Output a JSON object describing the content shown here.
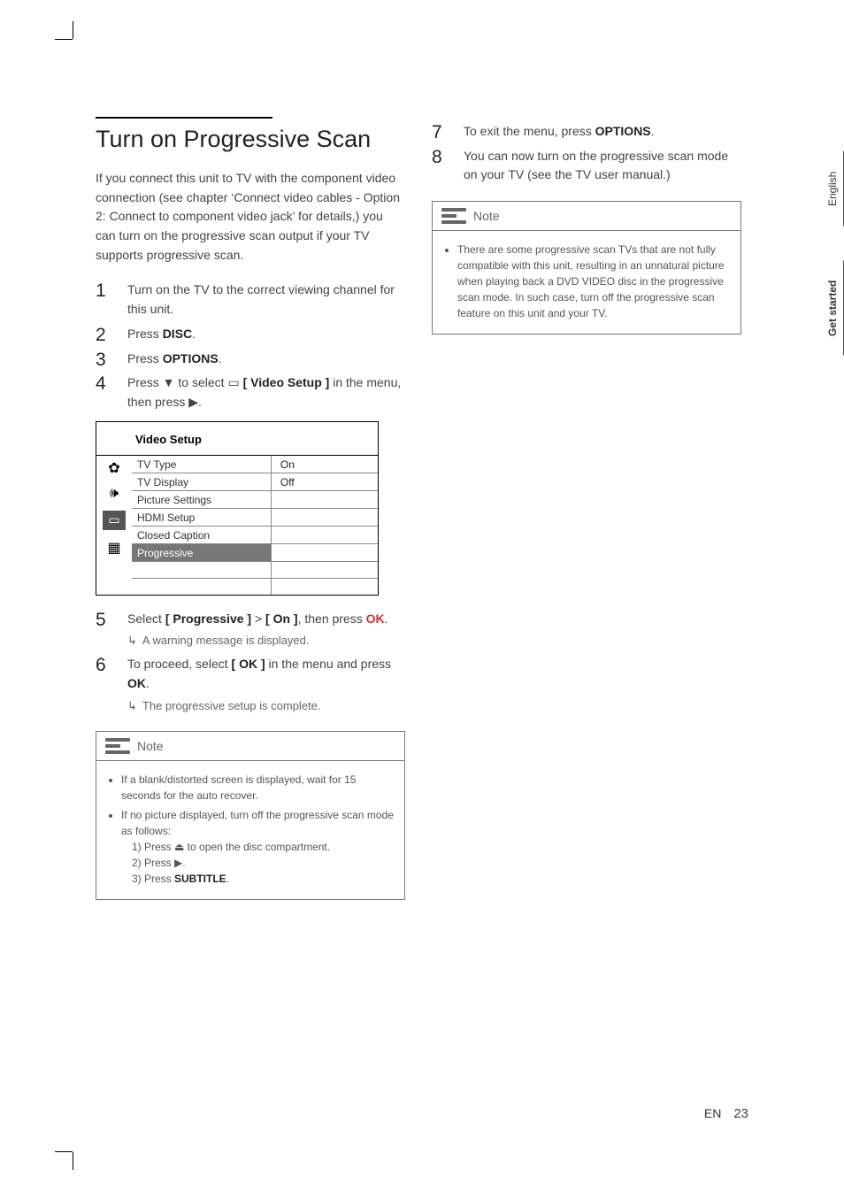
{
  "side_tabs": {
    "language": "English",
    "section": "Get started"
  },
  "footer": {
    "lang_code": "EN",
    "page_number": "23"
  },
  "heading": "Turn on Progressive Scan",
  "intro": "If you connect this unit to TV with the component video connection (see chapter ‘Connect video cables - Option 2: Connect to component video jack’ for details,) you can turn on the progressive scan output if your TV supports progressive scan.",
  "steps": {
    "s1": "Turn on the TV to the correct viewing channel for this unit.",
    "s2_a": "Press ",
    "s2_b": "DISC",
    "s2_c": ".",
    "s3_a": "Press ",
    "s3_b": "OPTIONS",
    "s3_c": ".",
    "s4_a": "Press ▼ to select ",
    "s4_b": "[ Video Setup ]",
    "s4_c": " in the menu, then press ▶.",
    "s5_a": "Select ",
    "s5_b": "[ Progressive ]",
    "s5_c": " > ",
    "s5_d": "[ On ]",
    "s5_e": ", then press ",
    "s5_ok": "OK",
    "s5_f": ".",
    "s5_sub": "A warning message is displayed.",
    "s6_a": "To proceed, select ",
    "s6_b": "[ OK ]",
    "s6_c": " in the menu and press ",
    "s6_d": "OK",
    "s6_e": ".",
    "s6_sub": "The progressive setup is complete.",
    "s7_a": "To exit the menu, press ",
    "s7_b": "OPTIONS",
    "s7_c": ".",
    "s8": "You can now turn on the progressive scan mode on your TV (see the TV user manual.)"
  },
  "osd": {
    "title": "Video Setup",
    "items": {
      "tv_type": "TV Type",
      "tv_display": "TV Display",
      "picture_settings": "Picture Settings",
      "hdmi_setup": "HDMI Setup",
      "closed_caption": "Closed Caption",
      "progressive": "Progressive"
    },
    "values": {
      "on": "On",
      "off": "Off"
    }
  },
  "note1": {
    "title": "Note",
    "bullet1": "If a blank/distorted screen is displayed, wait for 15 seconds for the auto recover.",
    "bullet2": "If no picture displayed, turn off the progressive scan mode as follows:",
    "sub1": "1)  Press ⏏ to open the disc compartment.",
    "sub2": "2)  Press ▶.",
    "sub3_a": "3)  Press ",
    "sub3_b": "SUBTITLE",
    "sub3_c": "."
  },
  "note2": {
    "title": "Note",
    "bullet1": "There are some progressive scan TVs that are not fully compatible with this unit, resulting in an unnatural picture when playing back a DVD VIDEO disc in the progressive scan mode. In such case, turn off the progressive scan feature on this unit and your TV."
  },
  "icons": {
    "display": "▭"
  }
}
